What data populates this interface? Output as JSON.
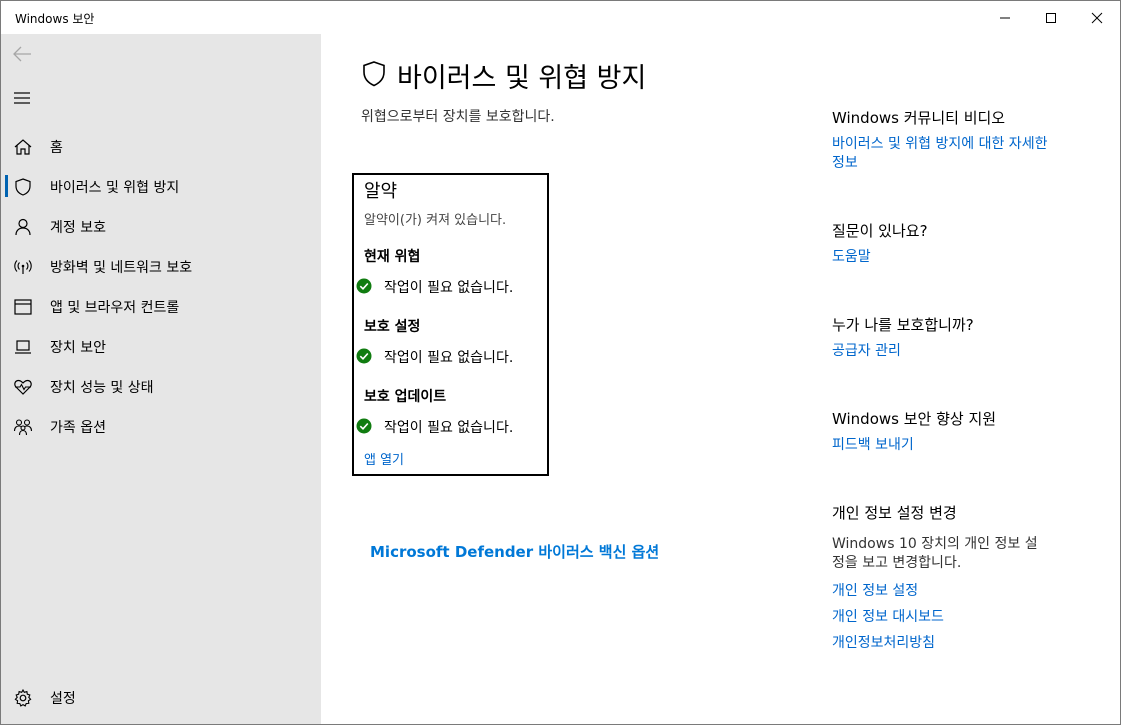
{
  "window": {
    "title": "Windows 보안"
  },
  "sidebar": {
    "items": [
      {
        "label": "홈",
        "icon": "home-icon"
      },
      {
        "label": "바이러스 및 위협 방지",
        "icon": "shield-icon",
        "active": true
      },
      {
        "label": "계정 보호",
        "icon": "person-icon"
      },
      {
        "label": "방화벽 및 네트워크 보호",
        "icon": "wifi-antenna-icon"
      },
      {
        "label": "앱 및 브라우저 컨트롤",
        "icon": "browser-window-icon"
      },
      {
        "label": "장치 보안",
        "icon": "laptop-icon"
      },
      {
        "label": "장치 성능 및 상태",
        "icon": "heart-pulse-icon"
      },
      {
        "label": "가족 옵션",
        "icon": "family-icon"
      }
    ],
    "settings_label": "설정"
  },
  "main": {
    "title": "바이러스 및 위협 방지",
    "subtitle": "위협으로부터 장치를 보호합니다.",
    "card": {
      "title": "알약",
      "status": "알약이(가) 켜져 있습니다.",
      "sections": [
        {
          "heading": "현재 위협",
          "status": "작업이 필요 없습니다."
        },
        {
          "heading": "보호 설정",
          "status": "작업이 필요 없습니다."
        },
        {
          "heading": "보호 업데이트",
          "status": "작업이 필요 없습니다."
        }
      ],
      "open_link": "앱 열기"
    },
    "defender_link": "Microsoft Defender 바이러스 백신 옵션"
  },
  "side": {
    "community": {
      "heading": "Windows 커뮤니티 비디오",
      "link_line1": "바이러스 및 위협 방지에 대한 자세한",
      "link_line2": "정보"
    },
    "question": {
      "heading": "질문이 있나요?",
      "link": "도움말"
    },
    "who": {
      "heading": "누가 나를 보호합니까?",
      "link": "공급자 관리"
    },
    "improve": {
      "heading": "Windows 보안 향상 지원",
      "link": "피드백 보내기"
    },
    "privacy": {
      "heading": "개인 정보 설정 변경",
      "text_line1": "Windows 10 장치의 개인 정보 설",
      "text_line2": "정을 보고 변경합니다.",
      "links": [
        "개인 정보 설정",
        "개인 정보 대시보드",
        "개인정보처리방침"
      ]
    }
  },
  "colors": {
    "accent": "#0078d7",
    "link": "#0066cc",
    "ok_green": "#107c10",
    "sidebar_bg": "#e6e6e6"
  }
}
